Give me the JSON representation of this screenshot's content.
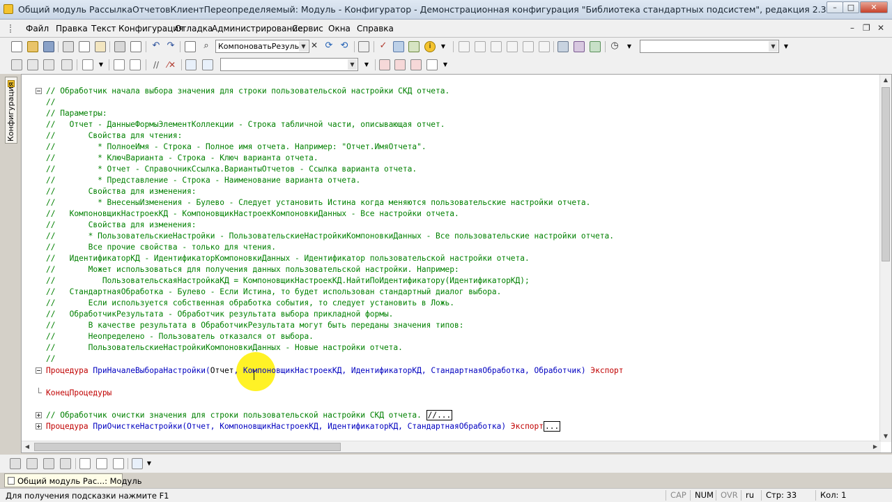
{
  "window": {
    "title": "Общий модуль РассылкаОтчетовКлиентПереопределяемый: Модуль - Конфигуратор - Демонстрационная конфигурация \"Библиотека стандартных подсистем\", редакция 2.3",
    "minimize": "–",
    "maximize": "□",
    "close": "✕"
  },
  "menu": {
    "items": [
      "Файл",
      "Правка",
      "Текст",
      "Конфигурация",
      "Отладка",
      "Администрирование",
      "Сервис",
      "Окна",
      "Справка"
    ],
    "mdi_minimize": "–",
    "mdi_restore": "❐",
    "mdi_close": "✕"
  },
  "toolbar": {
    "search_value": "КомпоноватьРезульт",
    "search_clear": "✕",
    "right_combo_value": "",
    "module_combo_value": ""
  },
  "sidebar": {
    "tab_label": "Конфигурация"
  },
  "editor": {
    "line1": "// Обработчик начала выбора значения для строки пользовательской настройки СКД отчета.",
    "line2": "//",
    "line3": "// Параметры:",
    "line4": "//   Отчет - ДанныеФормыЭлементКоллекции - Строка табличной части, описывающая отчет.",
    "line5": "//       Свойства для чтения:",
    "line6": "//         * ПолноеИмя - Строка - Полное имя отчета. Например: \"Отчет.ИмяОтчета\".",
    "line7": "//         * КлючВарианта - Строка - Ключ варианта отчета.",
    "line8": "//         * Отчет - СправочникСсылка.ВариантыОтчетов - Ссылка варианта отчета.",
    "line9": "//         * Представление - Строка - Наименование варианта отчета.",
    "line10": "//       Свойства для изменения:",
    "line11": "//         * ВнесеныИзменения - Булево - Следует установить Истина когда меняются пользовательские настройки отчета.",
    "line12": "//   КомпоновщикНастроекКД - КомпоновщикНастроекКомпоновкиДанных - Все настройки отчета.",
    "line13": "//       Свойства для изменения:",
    "line14": "//       * ПользовательскиеНастройки - ПользовательскиеНастройкиКомпоновкиДанных - Все пользовательские настройки отчета.",
    "line15": "//       Все прочие свойства - только для чтения.",
    "line16": "//   ИдентификаторКД - ИдентификаторКомпоновкиДанных - Идентификатор пользовательской настройки отчета.",
    "line17": "//       Может использоваться для получения данных пользовательской настройки. Например:",
    "line18": "//          ПользовательскаяНастройкаКД = КомпоновщикНастроекКД.НайтиПоИдентификатору(ИдентификаторКД);",
    "line19": "//   СтандартнаяОбработка - Булево - Если Истина, то будет использован стандартный диалог выбора.",
    "line20": "//       Если используется собственная обработка события, то следует установить в Ложь.",
    "line21": "//   ОбработчикРезультата - Обработчик результата выбора прикладной формы.",
    "line22": "//       В качестве результата в ОбработчикРезультата могут быть переданы значения типов:",
    "line23": "//       Неопределено - Пользователь отказался от выбора.",
    "line24": "//       ПользовательскиеНастройкиКомпоновкиДанных - Новые настройки отчета.",
    "line25": "//",
    "proc1_keyword": "Процедура",
    "proc1_name": "ПриНачалеВыбораНастройки(",
    "proc1_param1": "Отчет",
    "proc1_rest": ", КомпоновщикНастроекКД, ИдентификаторКД, СтандартнаяОбработка, Обработчик)",
    "proc1_export": "Экспорт",
    "proc1_end": "КонецПроцедуры",
    "collapsed_comment": "// Обработчик очистки значения для строки пользовательской настройки СКД отчета.",
    "collapsed_comment_box": "//...",
    "proc2_keyword": "Процедура",
    "proc2_name": "ПриОчисткеНастройки(Отчет, КомпоновщикНастроекКД, ИдентификаторКД, СтандартнаяОбработка)",
    "proc2_export": "Экспорт",
    "proc2_box": "..."
  },
  "taskbar": {
    "tab_label": "Общий модуль Рас...: Модуль"
  },
  "status": {
    "hint": "Для получения подсказки нажмите F1",
    "cap": "CAP",
    "num": "NUM",
    "ovr": "OVR",
    "lang": "ru",
    "line": "Стр: 33",
    "col": "Кол: 1"
  },
  "colors": {
    "comment": "#008000",
    "keyword": "#c00000",
    "identifier": "#0000c0",
    "cursor_highlight": "#fff000"
  }
}
